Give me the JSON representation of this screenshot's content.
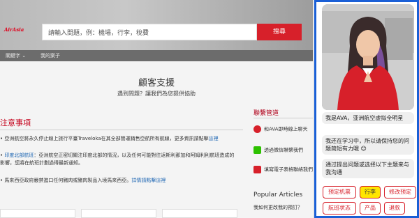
{
  "brand": {
    "logo_text": "AirAsia",
    "accent": "#d7202a",
    "panel_border": "#1a5fd6"
  },
  "header": {
    "search_placeholder": "請輸入問題，例：機場，行李，稅費",
    "search_button": "搜尋"
  },
  "subnav": {
    "items": [
      "關鍵字",
      "我的案子"
    ]
  },
  "main": {
    "title": "顧客支援",
    "subtitle": "遇到問題？讓我們為您提供協助",
    "notice_heading": "注意事項",
    "notices": [
      {
        "text": "亞洲航空將永久停止線上旅行平臺Traveloka在其全部營運銷售亞航所有航線，更多資訊請點擊",
        "link": "這裡"
      },
      {
        "link_lead": "印度北部航班",
        "text": "：亞洲航空正密切關注印度北部的情況，以及任何可能對往返斯利那加和阿姆利則航班造成的影響，您將在航班計劃過得最新通知。"
      },
      {
        "text": "馬來西亞政府嚴禁進口任何豬肉或豬肉製品入境馬來西亞。",
        "link": "詳情請點擊這裡"
      }
    ]
  },
  "contact": {
    "heading": "聯繫管道",
    "items": [
      "和AVA即時線上聊天",
      "透過微信聯繫我們",
      "填寫電子表格聯絡我們"
    ]
  },
  "popular": {
    "heading": "Popular Articles",
    "items": [
      "我如何更改我的預訂？"
    ]
  },
  "chat": {
    "messages": [
      "我是AVA，亚洲航空虚拟全明星",
      "我还在学习中，所以请保持您的问题简短有力哦 😊",
      "通过提出问题或选择以下主题来与我沟通"
    ],
    "quick_replies": [
      "预定机票",
      "行李",
      "修改预定",
      "航班状态",
      "产品",
      "退款"
    ],
    "active_reply": "行李"
  }
}
